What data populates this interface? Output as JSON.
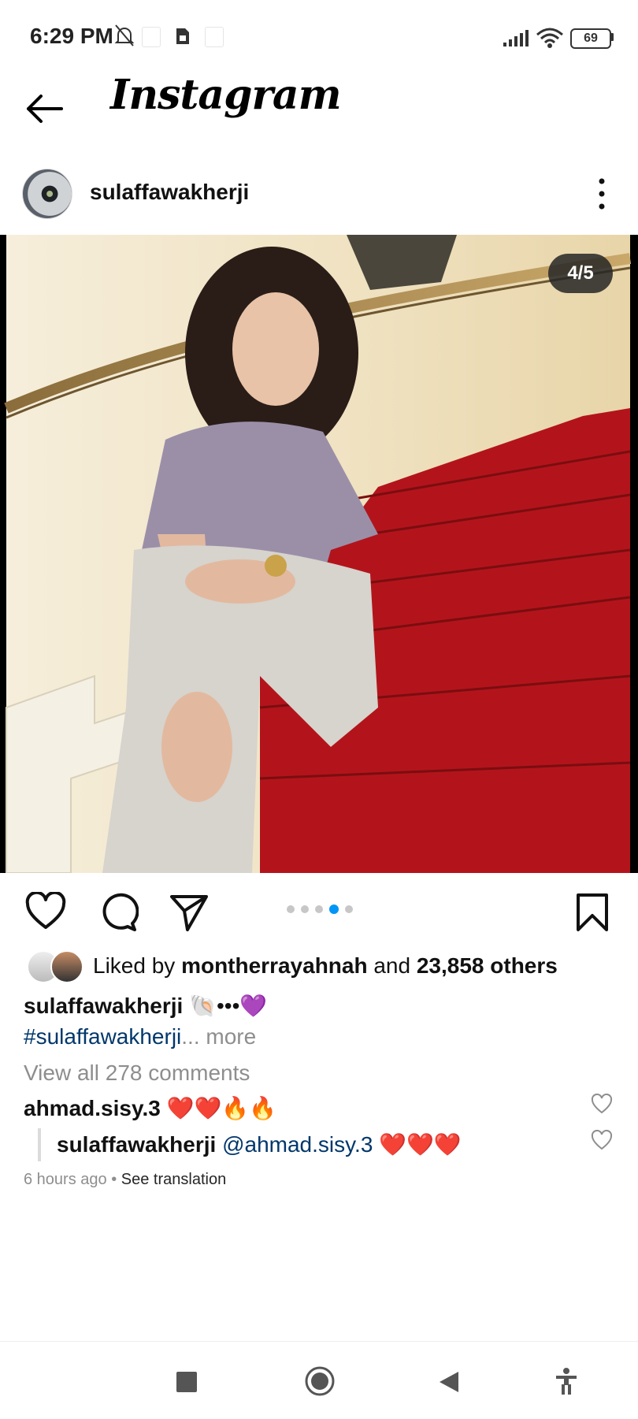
{
  "status_bar": {
    "time": "6:29 PM",
    "battery": "69",
    "icons": [
      "bell-off-icon",
      "sim-icon",
      "signal-icon",
      "wifi-icon",
      "battery-icon"
    ]
  },
  "header": {
    "logo_text": "Instagram",
    "back_icon": "arrow-left-icon"
  },
  "post": {
    "username": "sulaffawakherji",
    "menu_icon": "more-vertical-icon",
    "photo_counter": "4/5",
    "carousel": {
      "count": 5,
      "active_index": 3
    },
    "actions": [
      "heart-icon",
      "comment-icon",
      "share-icon",
      "bookmark-icon"
    ],
    "likes": {
      "prefix": "Liked by",
      "user": "montherrayahnah",
      "middle": "and",
      "others": "23,858 others"
    },
    "caption": {
      "user": "sulaffawakherji",
      "text": "🐚•••💜",
      "hashtag": "#sulaffawakherji",
      "ellipsis": "...",
      "more": "more"
    },
    "view_comments": "View all 278 comments",
    "comments": [
      {
        "user": "ahmad.sisy.3",
        "text": "❤️❤️🔥🔥"
      },
      {
        "user": "sulaffawakherji",
        "mention": "@ahmad.sisy.3",
        "text": "❤️❤️❤️"
      }
    ],
    "time_ago": "6 hours ago",
    "separator": "•",
    "see_translation": "See translation"
  },
  "colors": {
    "link_blue": "#00376b",
    "dot_active": "#0095f6",
    "muted": "#8e8e8e",
    "carpet_red": "#b3141b"
  },
  "nav_bar": {
    "icons": [
      "recents-square-icon",
      "home-circle-icon",
      "back-triangle-icon",
      "accessibility-icon"
    ]
  }
}
